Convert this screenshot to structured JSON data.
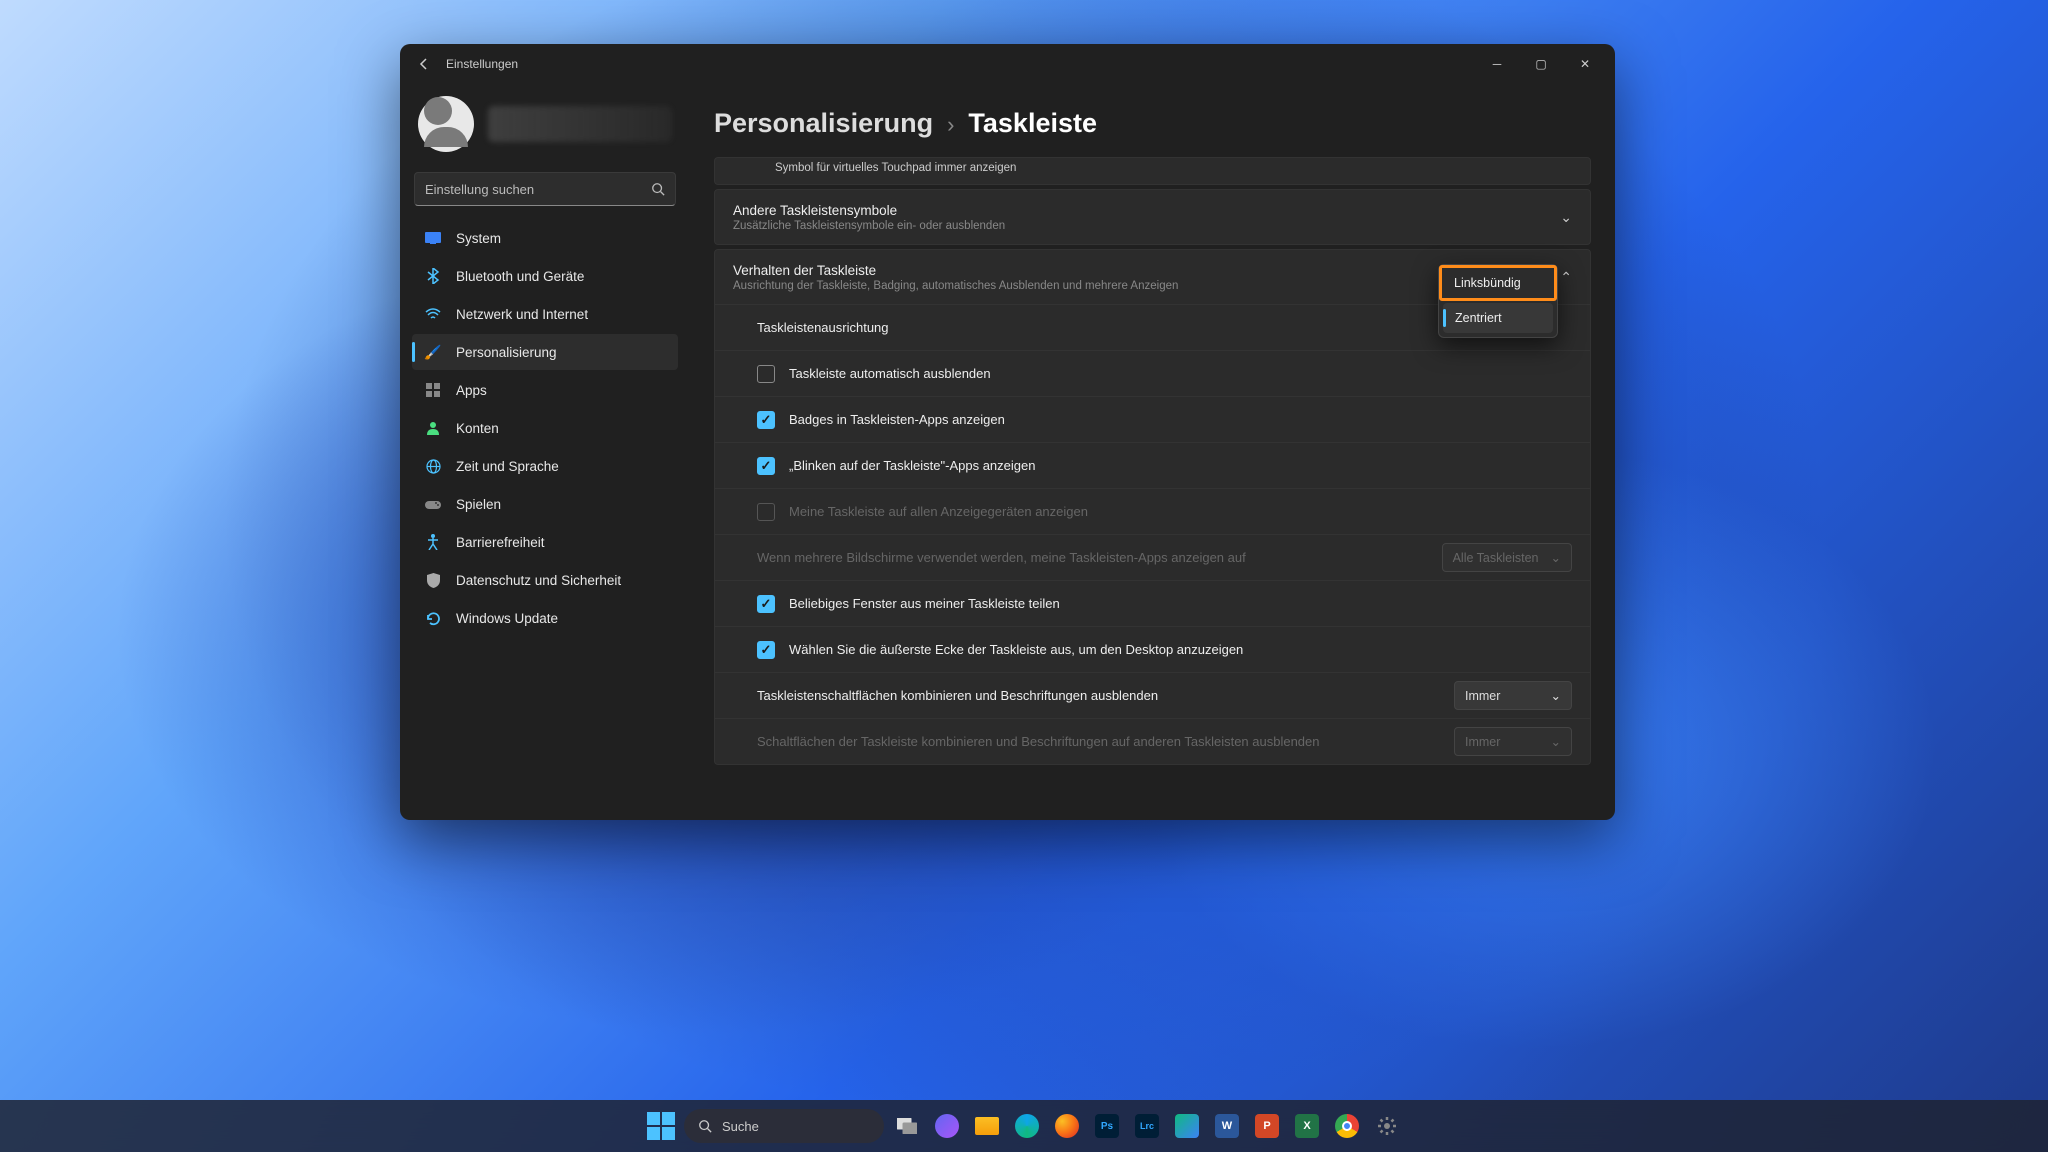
{
  "window": {
    "title": "Einstellungen",
    "search_placeholder": "Einstellung suchen"
  },
  "breadcrumb": {
    "parent": "Personalisierung",
    "current": "Taskleiste"
  },
  "nav": [
    {
      "label": "System",
      "icon": "💻"
    },
    {
      "label": "Bluetooth und Geräte",
      "icon": ""
    },
    {
      "label": "Netzwerk und Internet",
      "icon": ""
    },
    {
      "label": "Personalisierung",
      "icon": "🖌",
      "active": true
    },
    {
      "label": "Apps",
      "icon": ""
    },
    {
      "label": "Konten",
      "icon": ""
    },
    {
      "label": "Zeit und Sprache",
      "icon": ""
    },
    {
      "label": "Spielen",
      "icon": ""
    },
    {
      "label": "Barrierefreiheit",
      "icon": ""
    },
    {
      "label": "Datenschutz und Sicherheit",
      "icon": ""
    },
    {
      "label": "Windows Update",
      "icon": ""
    }
  ],
  "partial_row": "Symbol für virtuelles Touchpad immer anzeigen",
  "other_icons": {
    "title": "Andere Taskleistensymbole",
    "subtitle": "Zusätzliche Taskleistensymbole ein- oder ausblenden"
  },
  "behavior": {
    "title": "Verhalten der Taskleiste",
    "subtitle": "Ausrichtung der Taskleiste, Badging, automatisches Ausblenden und mehrere Anzeigen",
    "alignment_label": "Taskleistenausrichtung",
    "alignment_options": {
      "left": "Linksbündig",
      "center": "Zentriert"
    },
    "items": [
      {
        "label": "Taskleiste automatisch ausblenden",
        "checked": false
      },
      {
        "label": "Badges in Taskleisten-Apps anzeigen",
        "checked": true
      },
      {
        "label": "„Blinken auf der Taskleiste\"-Apps anzeigen",
        "checked": true
      },
      {
        "label": "Meine Taskleiste auf allen Anzeigegeräten anzeigen",
        "checked": false,
        "disabled": true
      }
    ],
    "multi_label": "Wenn mehrere Bildschirme verwendet werden, meine Taskleisten-Apps anzeigen auf",
    "multi_value": "Alle Taskleisten",
    "share_label": "Beliebiges Fenster aus meiner Taskleiste teilen",
    "corner_label": "Wählen Sie die äußerste Ecke der Taskleiste aus, um den Desktop anzuzeigen",
    "combine_label": "Taskleistenschaltflächen kombinieren und Beschriftungen ausblenden",
    "combine_value": "Immer",
    "combine_other_label": "Schaltflächen der Taskleiste kombinieren und Beschriftungen auf anderen Taskleisten ausblenden",
    "combine_other_value": "Immer"
  },
  "taskbar": {
    "search": "Suche"
  }
}
